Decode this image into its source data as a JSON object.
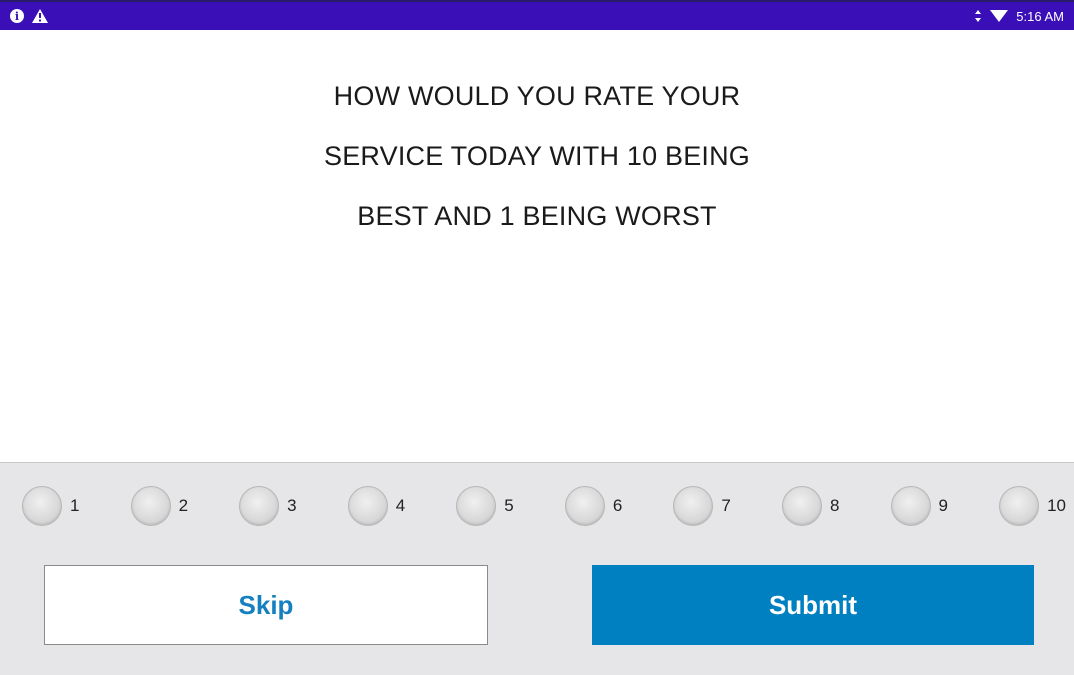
{
  "status_bar": {
    "time": "5:16 AM",
    "icons": [
      "info-icon",
      "warning-icon",
      "data-arrows-icon",
      "wifi-icon"
    ],
    "background_color": "#3a0fb7"
  },
  "question": {
    "lines": [
      "HOW WOULD YOU RATE YOUR",
      "SERVICE TODAY WITH 10 BEING",
      "BEST AND 1 BEING WORST"
    ]
  },
  "rating": {
    "options": [
      "1",
      "2",
      "3",
      "4",
      "5",
      "6",
      "7",
      "8",
      "9",
      "10"
    ],
    "selected": null
  },
  "buttons": {
    "skip_label": "Skip",
    "submit_label": "Submit",
    "accent_color": "#0080c0"
  }
}
